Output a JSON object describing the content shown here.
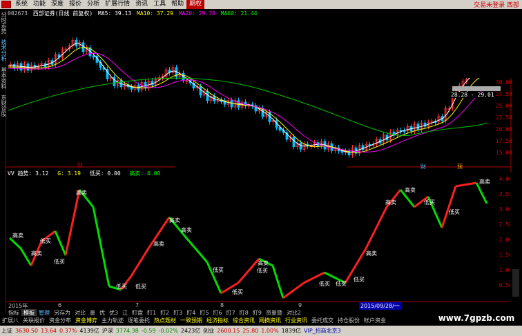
{
  "menu": {
    "items": [
      "系统",
      "功能",
      "深度",
      "报价",
      "分析",
      "扩展行情",
      "资讯",
      "工具",
      "帮助"
    ],
    "active": "期权",
    "right_text": "交易未登录  西部"
  },
  "left_tabs": [
    "分时走势",
    "技术分析",
    "基本资料",
    "东财诊股"
  ],
  "price_header": {
    "code": "002673",
    "name": "西部证券(日线 前复权)",
    "ma5": "MA5: 39.13",
    "ma10": "MA10: 37.29",
    "ma20": "MA20: 29.78",
    "ma60": "MA60: 21.44",
    "colors": {
      "ma5": "#ffffff",
      "ma10": "#ffff00",
      "ma20": "#ff00ff",
      "ma60": "#00ff00"
    }
  },
  "price_axis": [
    "30.00",
    "27.50",
    "25.00",
    "22.50",
    "20.00",
    "17.50",
    "15.00"
  ],
  "price_range_label": "28.28 - 29.01",
  "event_markers": [
    "财",
    "财",
    "预"
  ],
  "indicator": {
    "trend": "VV 趋势: 3.12",
    "g": "G: 3.19",
    "low_buy": "低买: 0.00",
    "high_sell": "高卖: 0.00",
    "axis": [
      "4.00",
      "3.50",
      "3.00",
      "2.50",
      "2.00",
      "1.50",
      "1.00",
      "0.50"
    ],
    "high_sell_label": "高卖",
    "low_buy_label": "低买"
  },
  "date_axis": {
    "labels": [
      "2015年",
      "6",
      "7",
      "8",
      "9"
    ],
    "current": "2015/09/28/一"
  },
  "tabs1": [
    "指标",
    "模板",
    "管理",
    "另存为",
    "对比",
    "量",
    "优",
    "优3",
    "江",
    "盯盘",
    "盯1",
    "盯2",
    "盯3",
    "盯4",
    "盯5",
    "盯6",
    "盯7",
    "盯8",
    "盯9",
    "资量暨",
    "对比2"
  ],
  "tabs2": [
    "扩展八",
    "关联报价",
    "资金分布",
    "资金博弈",
    "主力轨迹",
    "逐笔委托",
    "热点题材",
    "一致预期",
    "经济指标",
    "综合资讯",
    "网摘资讯",
    "行业资讯",
    "委托成交",
    "持仓股份",
    "帐户资金"
  ],
  "tabs2_yellow": [
    "资金博弈",
    "热点题材",
    "一致预期",
    "经济指标",
    "综合资讯",
    "网摘资讯",
    "行业资讯"
  ],
  "status": {
    "sh_label": "上证",
    "sh_value": "3630.50",
    "sh_change": "13.64",
    "sh_pct": "0.37%",
    "sh_amount": "4139亿",
    "hs_label": "沪深",
    "hs_value": "3774.38",
    "hs_change": "-0.59",
    "hs_pct": "-0.02%",
    "hs_amount": "2423亿",
    "cy_label": "创业",
    "cy_value": "2600.15",
    "cy_change": "25.80",
    "cy_pct": "1.00%",
    "cy_amount": "1839亿",
    "vip": "VIP_招商北京3"
  },
  "watermark": "www.7gpzb.com"
}
